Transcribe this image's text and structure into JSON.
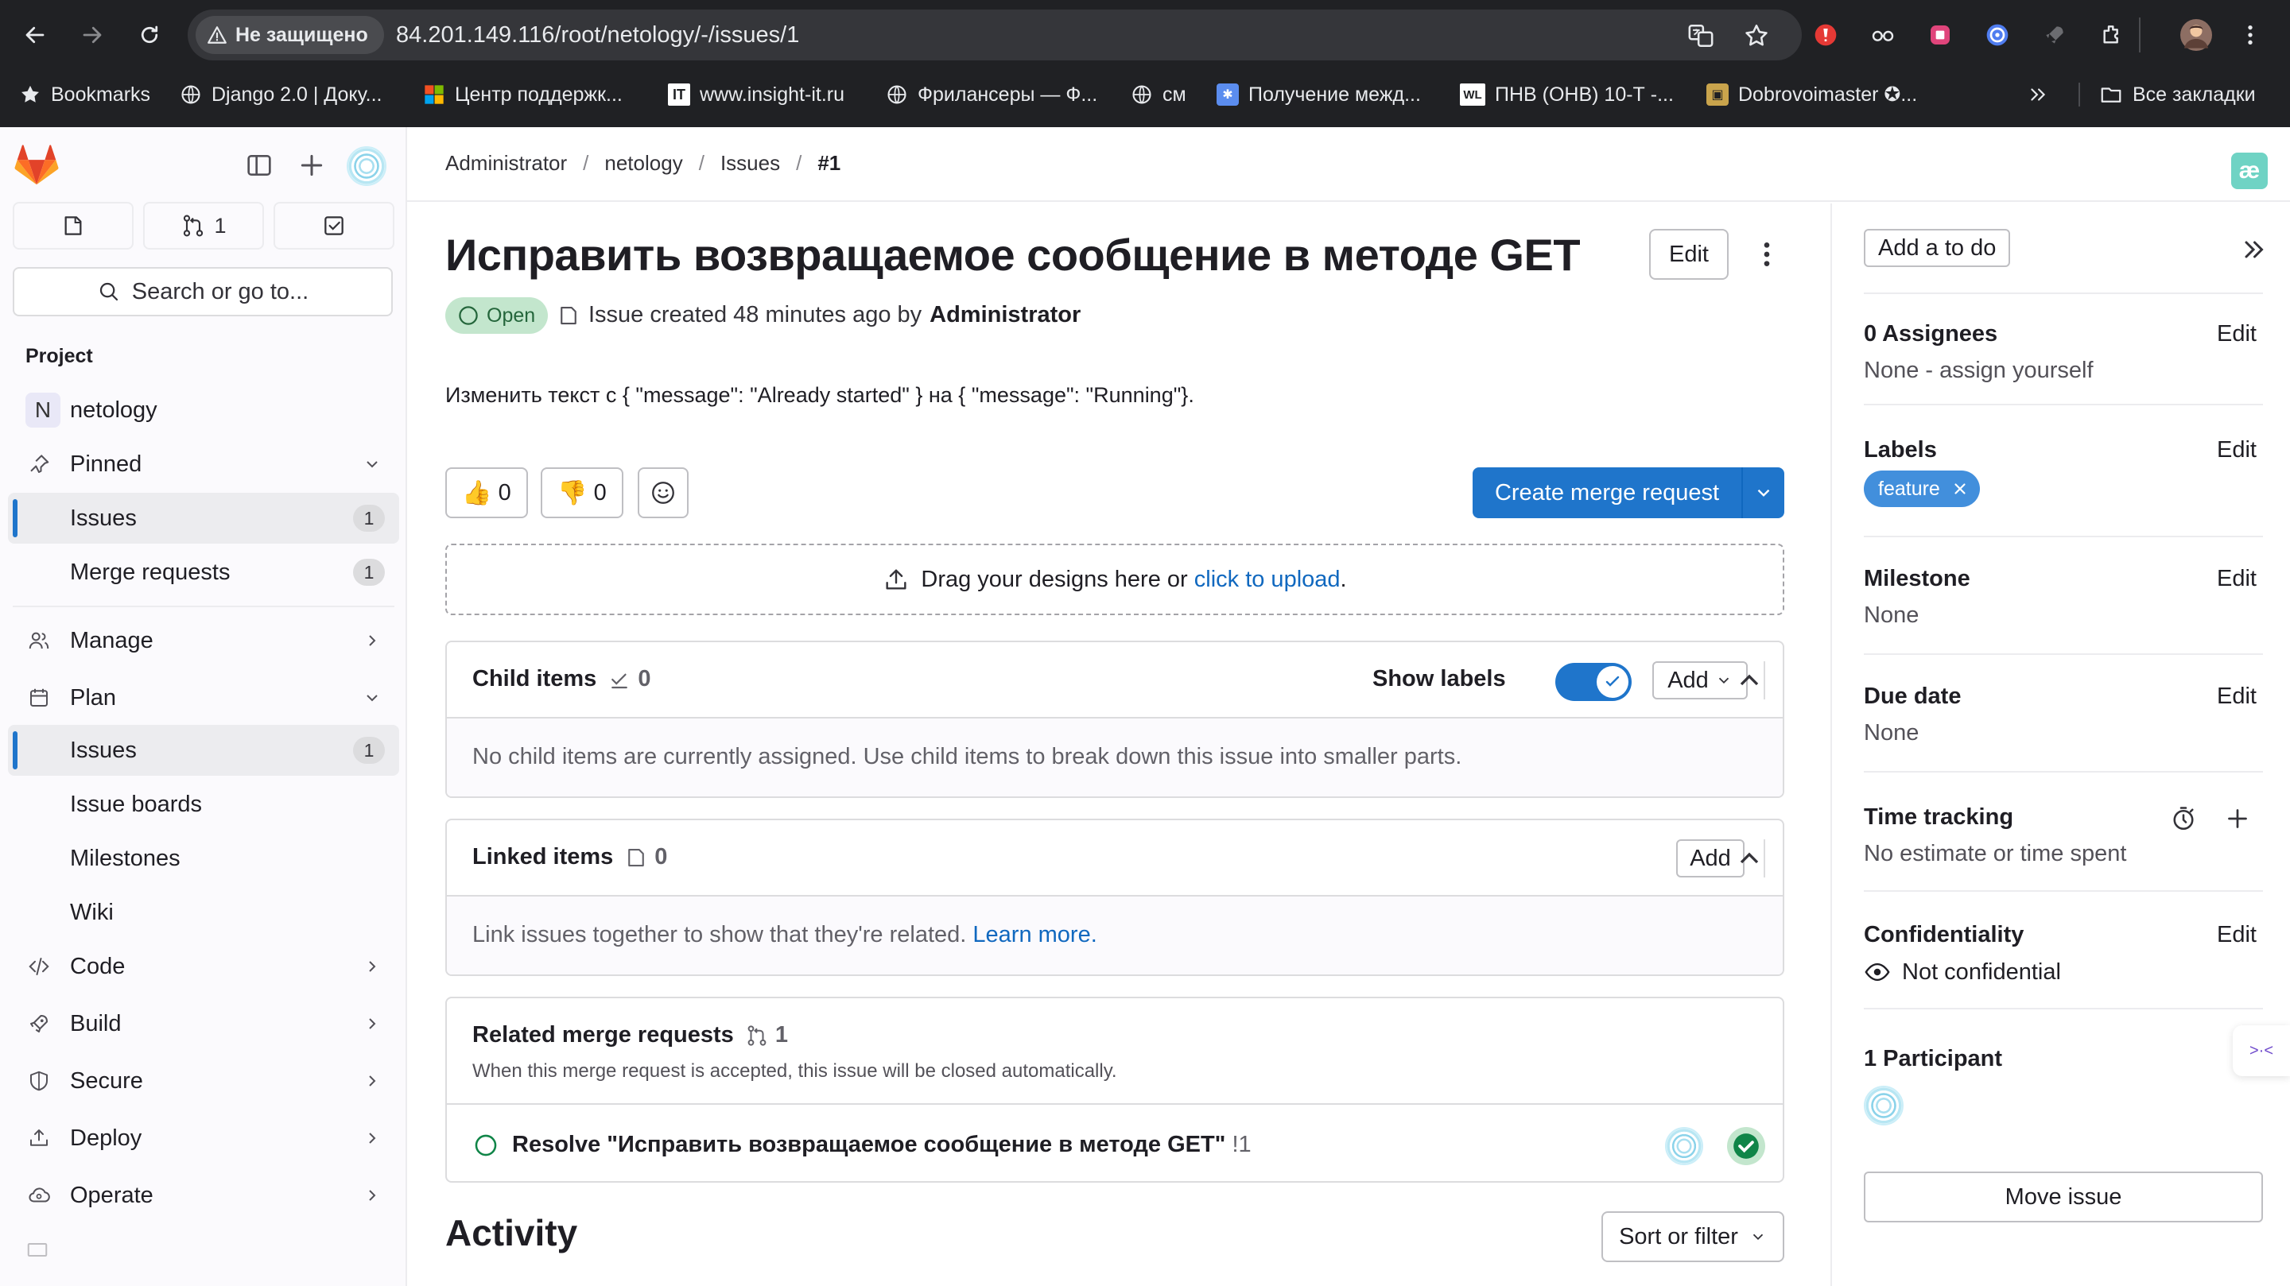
{
  "browser": {
    "security_label": "Не защищено",
    "url": "84.201.149.116/root/netology/-/issues/1",
    "bookmarks": [
      {
        "label": "Bookmarks",
        "icon": "star-icon"
      },
      {
        "label": "Django 2.0 | Доку...",
        "icon": "globe-icon"
      },
      {
        "label": "Центр поддержк...",
        "icon": "windows-icon"
      },
      {
        "label": "www.insight-it.ru",
        "icon": "it-icon"
      },
      {
        "label": "Фрилансеры — Ф...",
        "icon": "globe-icon"
      },
      {
        "label": "см",
        "icon": "globe-icon"
      },
      {
        "label": "Получение межд...",
        "icon": "snowflake-icon"
      },
      {
        "label": "ПНВ (ОНВ) 10-Т -...",
        "icon": "wl-icon"
      },
      {
        "label": "Dobrovoimaster ✪...",
        "icon": "site-icon"
      }
    ],
    "all_bookmarks": "Все закладки"
  },
  "sidebar": {
    "merge_count": "1",
    "search_placeholder": "Search or go to...",
    "section": "Project",
    "project_initial": "N",
    "project_name": "netology",
    "pinned": "Pinned",
    "pinned_items": [
      {
        "label": "Issues",
        "count": "1"
      },
      {
        "label": "Merge requests",
        "count": "1"
      }
    ],
    "nav": {
      "manage": "Manage",
      "plan": "Plan",
      "plan_items": [
        {
          "label": "Issues",
          "count": "1"
        },
        {
          "label": "Issue boards"
        },
        {
          "label": "Milestones"
        },
        {
          "label": "Wiki"
        }
      ],
      "code": "Code",
      "build": "Build",
      "secure": "Secure",
      "deploy": "Deploy",
      "operate": "Operate"
    }
  },
  "breadcrumb": [
    "Administrator",
    "netology",
    "Issues",
    "#1"
  ],
  "issue": {
    "title": "Исправить возвращаемое сообщение в методе GET",
    "edit": "Edit",
    "status": "Open",
    "created": "Issue created 48 minutes ago by",
    "author": "Administrator",
    "description": "Изменить текст с { \"message\": \"Already started\" } на { \"message\": \"Running\"}.",
    "thumbs_up": "0",
    "thumbs_down": "0",
    "create_mr": "Create merge request",
    "upload_text": "Drag your designs here or",
    "upload_link": "click to upload",
    "upload_end": "."
  },
  "child_items": {
    "title": "Child items",
    "count": "0",
    "show_labels": "Show labels",
    "add": "Add",
    "empty": "No child items are currently assigned. Use child items to break down this issue into smaller parts."
  },
  "linked_items": {
    "title": "Linked items",
    "count": "0",
    "add": "Add",
    "text": "Link issues together to show that they're related.",
    "link": "Learn more."
  },
  "related_mrs": {
    "title": "Related merge requests",
    "count": "1",
    "subtitle": "When this merge request is accepted, this issue will be closed automatically.",
    "item_title": "Resolve \"Исправить возвращаемое сообщение в методе GET\"",
    "item_ref": "!1"
  },
  "activity": {
    "title": "Activity",
    "sort": "Sort or filter"
  },
  "right_sidebar": {
    "todo": "Add a to do",
    "edit": "Edit",
    "assignees": {
      "title": "0 Assignees",
      "value": "None - assign yourself"
    },
    "labels": {
      "title": "Labels",
      "chip": "feature",
      "chip_color": "#428fdc"
    },
    "milestone": {
      "title": "Milestone",
      "value": "None"
    },
    "due_date": {
      "title": "Due date",
      "value": "None"
    },
    "time_tracking": {
      "title": "Time tracking",
      "value": "No estimate or time spent"
    },
    "confidentiality": {
      "title": "Confidentiality",
      "value": "Not confidential"
    },
    "participants": {
      "title": "1 Participant"
    },
    "move_issue": "Move issue"
  },
  "colors": {
    "primary": "#1f75cb",
    "open_status_bg": "#c3e6cd",
    "open_status_fg": "#24663b",
    "chrome_bg": "#202124"
  }
}
